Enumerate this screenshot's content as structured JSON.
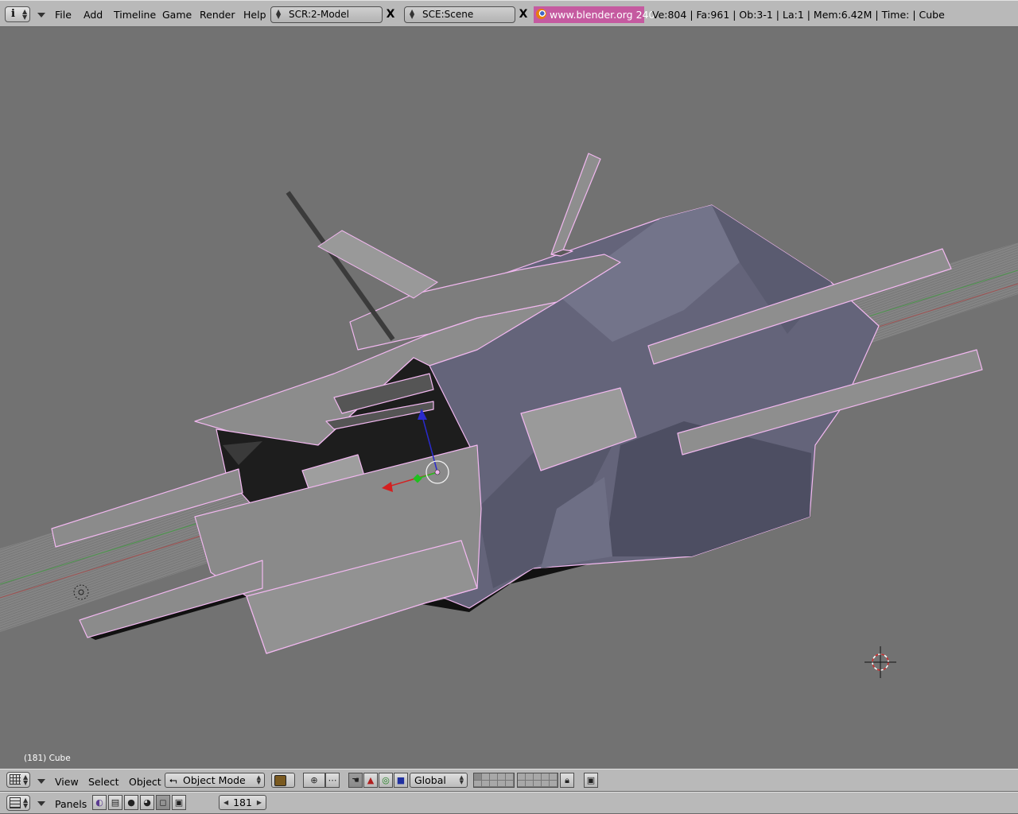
{
  "topbar": {
    "menus": [
      "File",
      "Add",
      "Timeline",
      "Game",
      "Render",
      "Help"
    ],
    "screen": "SCR:2-Model",
    "scene": "SCE:Scene",
    "close_symbol": "X",
    "website": "www.blender.org 240",
    "stats": "Ve:804 | Fa:961 | Ob:3-1 | La:1 | Mem:6.42M | Time: | Cube"
  },
  "viewport": {
    "object_label": "(181) Cube",
    "colors": {
      "background": "#727272",
      "selection_outline": "#f2b8f0",
      "x_axis": "#d02020",
      "y_axis": "#20c020",
      "z_axis": "#2020d0"
    }
  },
  "header3d": {
    "menus": [
      "View",
      "Select",
      "Object"
    ],
    "mode": "Object Mode",
    "orientation": "Global"
  },
  "buttons_header": {
    "panels_label": "Panels",
    "frame": "181"
  },
  "icons": [
    "info-icon",
    "view3d-icon",
    "buttons-window-icon",
    "blender-logo-icon",
    "object-mode-icon",
    "lock-icon",
    "render-icon"
  ]
}
